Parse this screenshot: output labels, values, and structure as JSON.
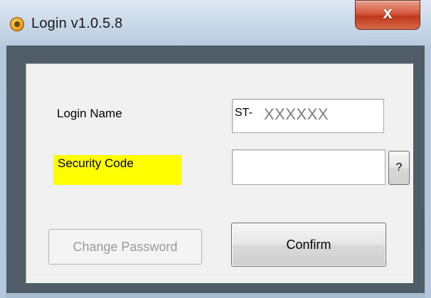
{
  "window": {
    "title": "Login v1.0.5.8",
    "close_label": "x"
  },
  "form": {
    "login_name_label": "Login Name",
    "login_name_prefix": "ST-",
    "login_name_value": "XXXXXX",
    "security_code_label": "Security Code",
    "security_code_value": "",
    "help_label": "?",
    "change_password_label": "Change Password",
    "confirm_label": "Confirm"
  },
  "colors": {
    "highlight": "#ffff00",
    "close_button": "#c7401e"
  }
}
